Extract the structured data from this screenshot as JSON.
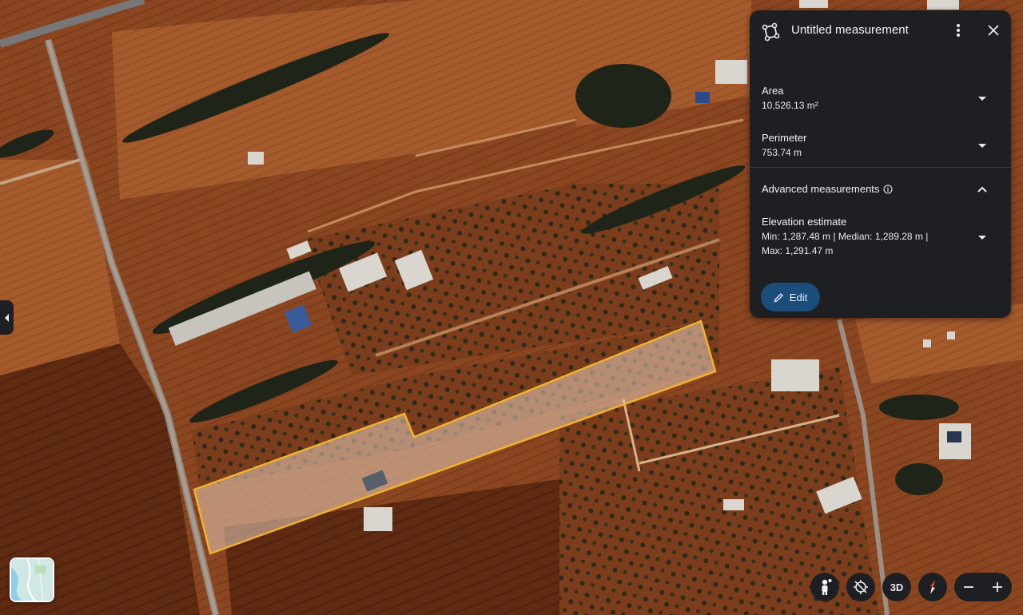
{
  "panel": {
    "title": "Untitled measurement",
    "area": {
      "label": "Area",
      "value": "10,526.13 m²"
    },
    "perimeter": {
      "label": "Perimeter",
      "value": "753.74 m"
    },
    "advanced": {
      "title": "Advanced measurements",
      "elevation_label": "Elevation estimate",
      "elevation_line1": "Min: 1,287.48 m | Median: 1,289.28 m |",
      "elevation_line2": "Max: 1,291.47 m"
    },
    "edit_label": "Edit"
  },
  "controls": {
    "view3d_label": "3D"
  },
  "colors": {
    "panel_bg": "#1e1f22",
    "edit_button": "#1b4d7a",
    "polygon_outline": "#f2b22a",
    "terrain": "#7a3e1c"
  },
  "icons": [
    "measure-polygon-icon",
    "more-vert-icon",
    "close-icon",
    "chevron-down-icon",
    "chevron-up-icon",
    "info-icon",
    "pencil-icon",
    "chevron-left-icon",
    "pegman-icon",
    "recenter-icon",
    "compass-icon",
    "zoom-out-icon",
    "zoom-in-icon"
  ]
}
